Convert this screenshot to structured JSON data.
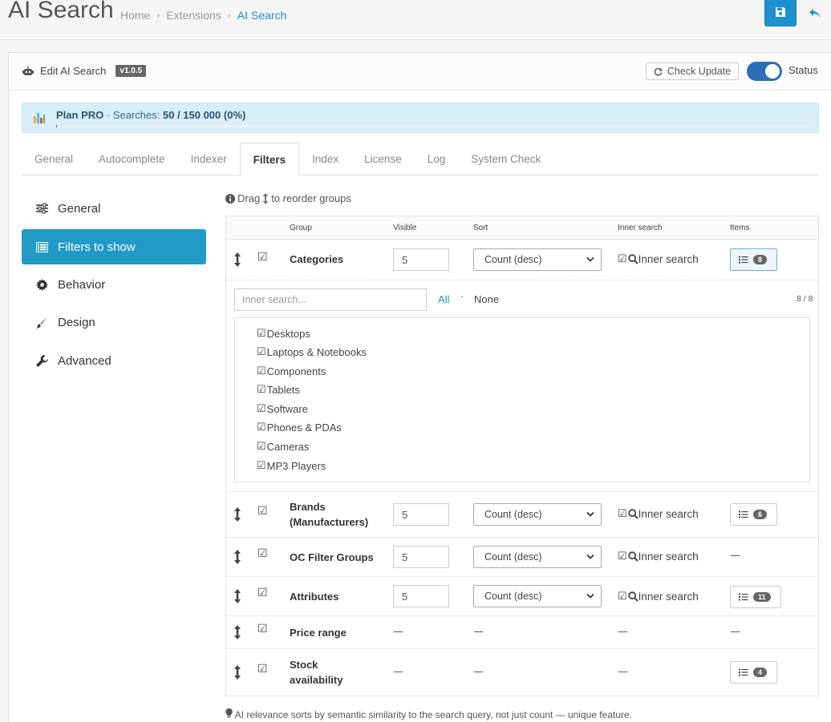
{
  "header": {
    "title": "AI Search",
    "breadcrumbs": [
      "Home",
      "Extensions",
      "AI Search"
    ]
  },
  "panel": {
    "title": "Edit AI Search",
    "version": "v1.0.5",
    "check_update": "Check Update",
    "status_label": "Status",
    "status_on": true
  },
  "plan": {
    "name": "Plan PRO",
    "searches_label": "· Searches:",
    "searches_value": "50 / 150 000 (0%)",
    "usage_fraction": 0.0003
  },
  "tabs": [
    {
      "label": "General",
      "active": false
    },
    {
      "label": "Autocomplete",
      "active": false
    },
    {
      "label": "Indexer",
      "active": false
    },
    {
      "label": "Filters",
      "active": true
    },
    {
      "label": "Index",
      "active": false
    },
    {
      "label": "License",
      "active": false
    },
    {
      "label": "Log",
      "active": false
    },
    {
      "label": "System Check",
      "active": false
    }
  ],
  "sidenav": [
    {
      "label": "General",
      "icon": "sliders-icon",
      "active": false
    },
    {
      "label": "Filters to show",
      "icon": "list-icon",
      "active": true
    },
    {
      "label": "Behavior",
      "icon": "gear-icon",
      "active": false
    },
    {
      "label": "Design",
      "icon": "brush-icon",
      "active": false
    },
    {
      "label": "Advanced",
      "icon": "wrench-icon",
      "active": false
    }
  ],
  "hint": {
    "before": "Drag",
    "after": "to reorder groups"
  },
  "table": {
    "headers": {
      "group": "Group",
      "visible": "Visible",
      "sort": "Sort",
      "inner_search": "Inner search",
      "items": "Items"
    },
    "rows": [
      {
        "group_line1": "Categories",
        "group_line2": "",
        "visible": "5",
        "sort": "Count (desc)",
        "inner": "Inner search",
        "items_count": "8"
      },
      {
        "group_line1": "Brands",
        "group_line2": "(Manufacturers)",
        "visible": "5",
        "sort": "Count (desc)",
        "inner": "Inner search",
        "items_count": "6"
      },
      {
        "group_line1": "OC Filter Groups",
        "group_line2": "",
        "visible": "5",
        "sort": "Count (desc)",
        "inner": "Inner search",
        "items_count": "—"
      },
      {
        "group_line1": "Attributes",
        "group_line2": "",
        "visible": "5",
        "sort": "Count (desc)",
        "inner": "Inner search",
        "items_count": "11"
      },
      {
        "group_line1": "Price range",
        "group_line2": "",
        "visible": "—",
        "sort": "—",
        "inner": "—",
        "items_count": "—"
      },
      {
        "group_line1": "Stock",
        "group_line2": "availability",
        "visible": "—",
        "sort": "—",
        "inner": "—",
        "items_count": "4"
      }
    ]
  },
  "categories_panel": {
    "search_placeholder": "Inner search...",
    "all": "All",
    "separator": "·",
    "none": "None",
    "count": "8 / 8",
    "items": [
      "Desktops",
      "Laptops & Notebooks",
      "Components",
      "Tablets",
      "Software",
      "Phones & PDAs",
      "Cameras",
      "MP3 Players"
    ]
  },
  "footnote": "AI relevance sorts by semantic similarity to the search query, not just count — unique feature."
}
